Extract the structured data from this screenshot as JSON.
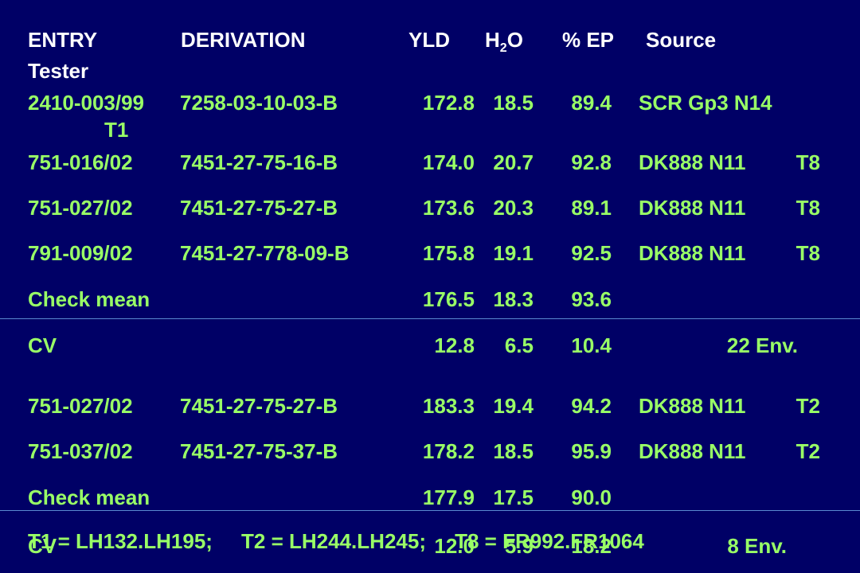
{
  "header": {
    "entry": "ENTRY",
    "derivation": "DERIVATION",
    "yld": "YLD",
    "h2o_main": "H",
    "h2o_sub": "2",
    "h2o_tail": "O",
    "ep": "% EP",
    "source": "Source",
    "tester": "Tester"
  },
  "rows": [
    {
      "entry": "2410-003/99",
      "derivation": "7258-03-10-03-B",
      "yld": "172.8",
      "h2o": "18.5",
      "ep": "89.4",
      "source": "SCR Gp3 N14",
      "tester": "T1"
    },
    {
      "entry": "751-016/02",
      "derivation": "7451-27-75-16-B",
      "yld": "174.0",
      "h2o": "20.7",
      "ep": "92.8",
      "source": "DK888 N11",
      "tester": "T8"
    },
    {
      "entry": "751-027/02",
      "derivation": "7451-27-75-27-B",
      "yld": "173.6",
      "h2o": "20.3",
      "ep": "89.1",
      "source": "DK888 N11",
      "tester": "T8"
    },
    {
      "entry": "791-009/02",
      "derivation": "7451-27-778-09-B",
      "yld": "175.8",
      "h2o": "19.1",
      "ep": "92.5",
      "source": "DK888 N11",
      "tester": "T8"
    },
    {
      "entry": "Check mean",
      "yld": "176.5",
      "h2o": "18.3",
      "ep": "93.6"
    },
    {
      "entry": "CV",
      "yld": "12.8",
      "h2o": "6.5",
      "ep": "10.4",
      "env": "22 Env."
    },
    {
      "entry": "751-027/02",
      "derivation": "7451-27-75-27-B",
      "yld": "183.3",
      "h2o": "19.4",
      "ep": "94.2",
      "source": "DK888 N11",
      "tester": "T2"
    },
    {
      "entry": "751-037/02",
      "derivation": "7451-27-75-37-B",
      "yld": "178.2",
      "h2o": "18.5",
      "ep": "95.9",
      "source": "DK888 N11",
      "tester": "T2"
    },
    {
      "entry": "Check mean",
      "yld": "177.9",
      "h2o": "17.5",
      "ep": "90.0"
    },
    {
      "entry": "CV",
      "yld": "12.0",
      "h2o": "5.9",
      "ep": "18.2",
      "env": "8 Env."
    }
  ],
  "footnote": "T1 = LH132.LH195;     T2 = LH244.LH245;     T8 = FR992.FR1064"
}
